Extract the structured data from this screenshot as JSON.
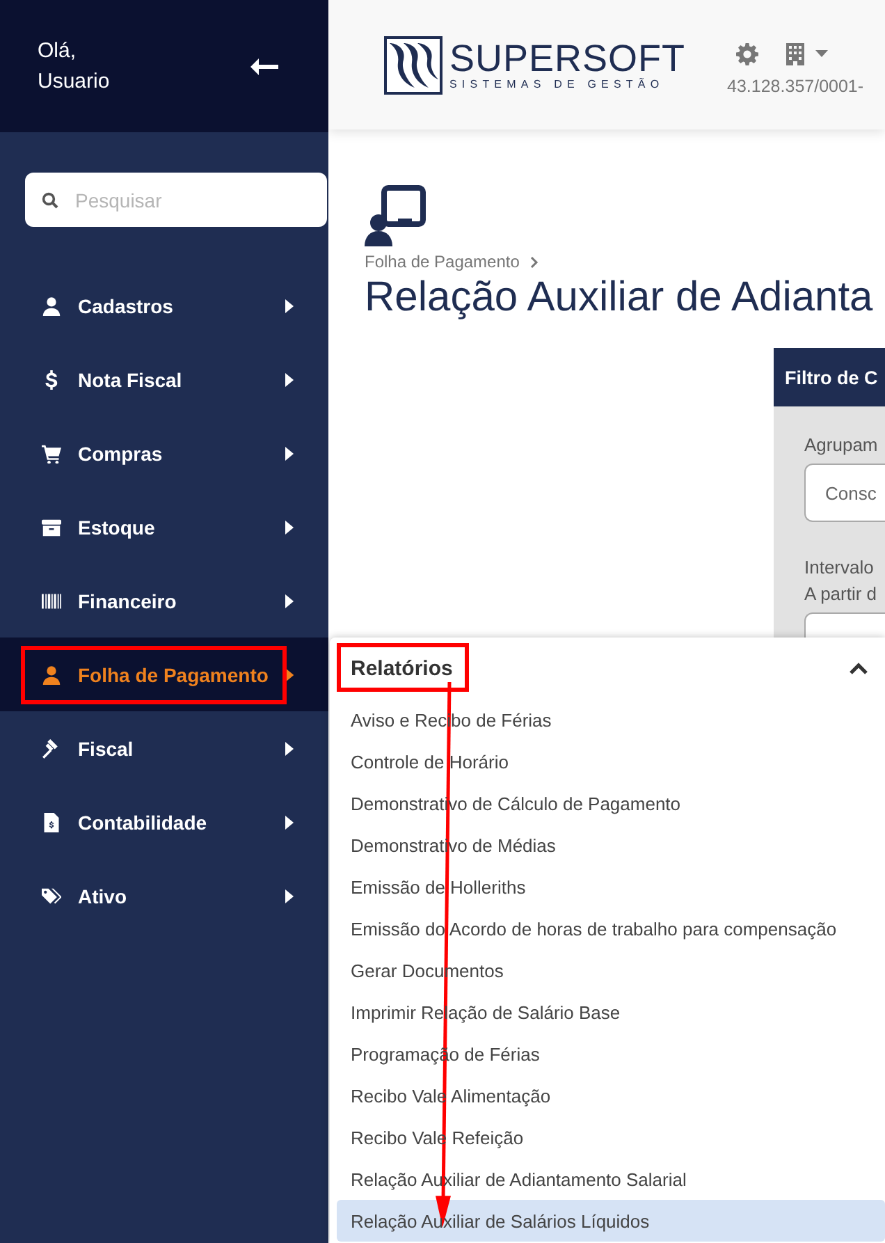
{
  "sidebar": {
    "greeting": "Olá,",
    "user": "Usuario",
    "search": {
      "placeholder": "Pesquisar"
    },
    "items": [
      {
        "label": "Cadastros",
        "selected": false,
        "outlined": false
      },
      {
        "label": "Nota Fiscal",
        "selected": false,
        "outlined": false
      },
      {
        "label": "Compras",
        "selected": false,
        "outlined": false
      },
      {
        "label": "Estoque",
        "selected": false,
        "outlined": false
      },
      {
        "label": "Financeiro",
        "selected": false,
        "outlined": false
      },
      {
        "label": "Folha de Pagamento",
        "selected": true,
        "outlined": true
      },
      {
        "label": "Fiscal",
        "selected": false,
        "outlined": false
      },
      {
        "label": "Contabilidade",
        "selected": false,
        "outlined": false
      },
      {
        "label": "Ativo",
        "selected": false,
        "outlined": false
      }
    ]
  },
  "header": {
    "logo_name": "SUPERSOFT",
    "logo_tagline": "SISTEMAS DE GESTÃO",
    "company_id": "43.128.357/0001-"
  },
  "page": {
    "breadcrumb": "Folha de Pagamento",
    "title": "Relação Auxiliar de Adianta"
  },
  "filter": {
    "title": "Filtro de C",
    "fields": [
      {
        "label": "Agrupam",
        "value": "Consc"
      },
      {
        "label": "Intervalo",
        "sublabel": "A partir d"
      }
    ]
  },
  "submenu": {
    "title": "Relatórios",
    "expanded": true,
    "outlined": true,
    "arrow_to_selected": true,
    "items": [
      {
        "label": "Aviso e Recibo de Férias",
        "selected": false
      },
      {
        "label": "Controle de Horário",
        "selected": false
      },
      {
        "label": "Demonstrativo de Cálculo de Pagamento",
        "selected": false
      },
      {
        "label": "Demonstrativo de Médias",
        "selected": false
      },
      {
        "label": "Emissão de Holleriths",
        "selected": false
      },
      {
        "label": "Emissão do Acordo de horas de trabalho para compensação",
        "selected": false
      },
      {
        "label": "Gerar Documentos",
        "selected": false
      },
      {
        "label": "Imprimir Relação de Salário Base",
        "selected": false
      },
      {
        "label": "Programação de Férias",
        "selected": false
      },
      {
        "label": "Recibo Vale Alimentação",
        "selected": false
      },
      {
        "label": "Recibo Vale Refeição",
        "selected": false
      },
      {
        "label": "Relação Auxiliar de Adiantamento Salarial",
        "selected": false
      },
      {
        "label": "Relação Auxiliar de Salários Líquidos",
        "selected": true
      }
    ]
  }
}
